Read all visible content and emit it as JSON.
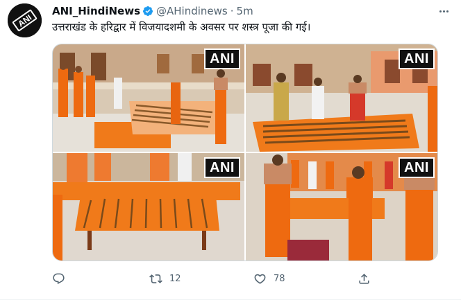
{
  "tweet": {
    "author_name": "ANI_HindiNews",
    "handle": "@AHindinews",
    "separator": "·",
    "time": "5m",
    "text": "उत्तराखंड के हरिद्वार में विजयादशमी के अवसर पर शस्त्र पूजा की गई।",
    "avatar_text": "ANI",
    "media": [
      {
        "watermark": "ANI"
      },
      {
        "watermark": "ANI"
      },
      {
        "watermark": "ANI"
      },
      {
        "watermark": "ANI"
      }
    ],
    "actions": {
      "reply_count": "",
      "retweet_count": "12",
      "like_count": "78",
      "share_count": ""
    }
  },
  "colors": {
    "text_primary": "#0f1419",
    "text_secondary": "#536471",
    "verified_blue": "#1d9bf0",
    "saffron": "#f07a1a"
  },
  "icons": [
    "verified-badge-icon",
    "more-options-icon",
    "reply-icon",
    "retweet-icon",
    "like-icon",
    "share-icon"
  ]
}
